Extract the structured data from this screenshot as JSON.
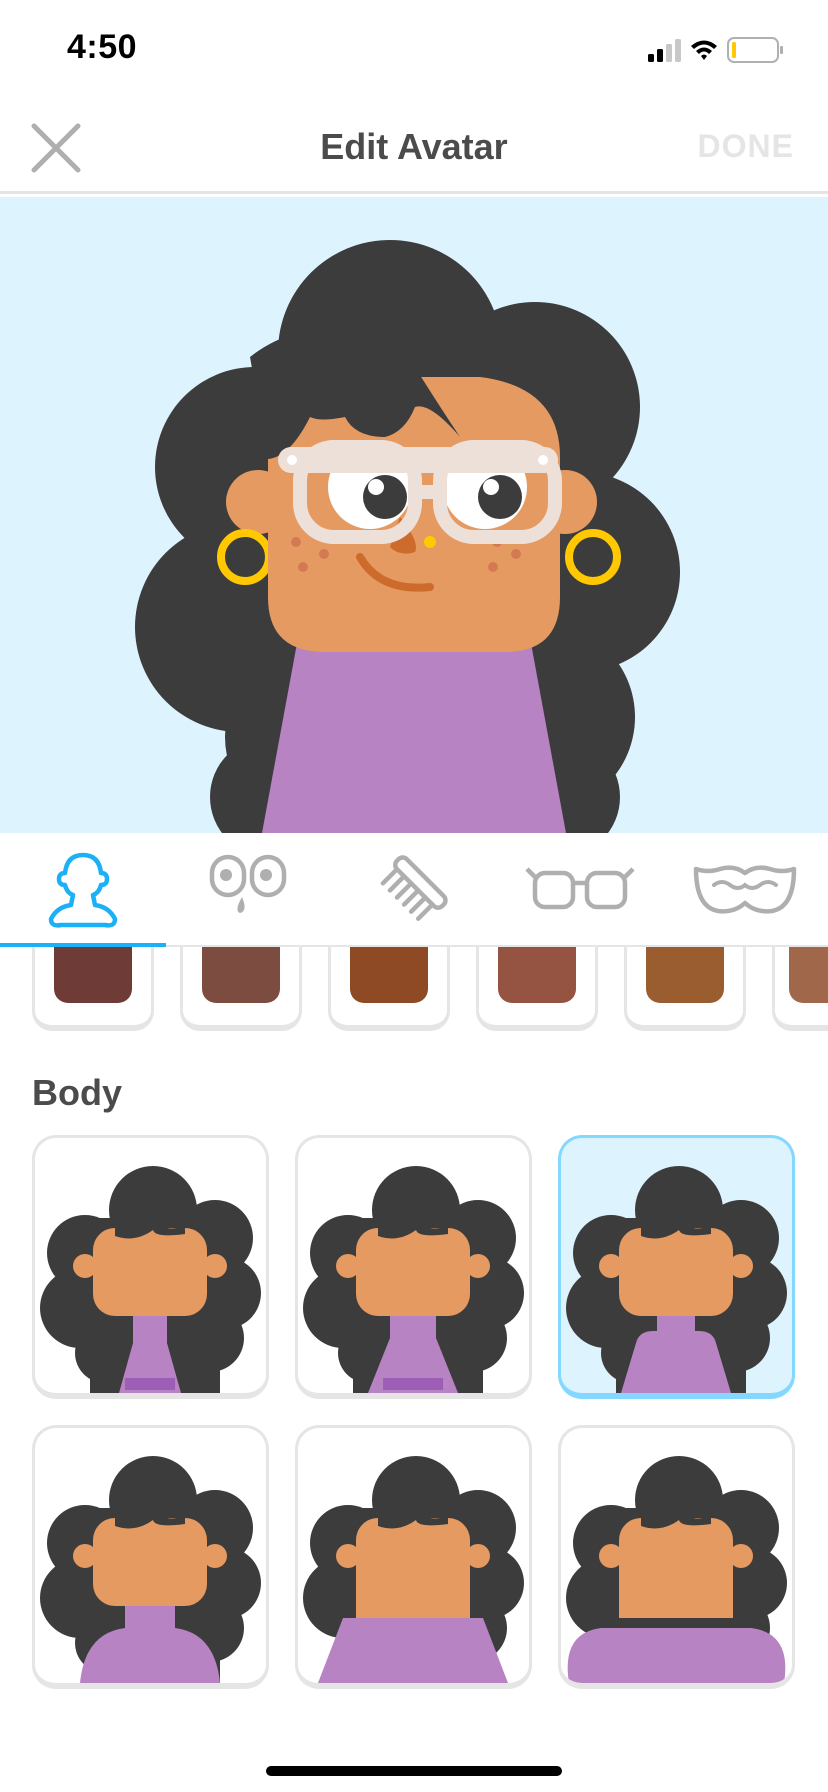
{
  "status_bar": {
    "time": "4:50",
    "icons": [
      "signal-icon",
      "wifi-icon",
      "battery-icon"
    ]
  },
  "header": {
    "title": "Edit Avatar",
    "close_icon": "close-icon",
    "done_label": "DONE"
  },
  "tabs": [
    {
      "name": "body",
      "icon": "body-icon",
      "active": true
    },
    {
      "name": "face",
      "icon": "face-icon",
      "active": false
    },
    {
      "name": "hair",
      "icon": "comb-icon",
      "active": false
    },
    {
      "name": "glasses",
      "icon": "glasses-icon",
      "active": false
    },
    {
      "name": "facial-hair",
      "icon": "mustache-icon",
      "active": false
    }
  ],
  "skin_swatches": [
    "#6f3b37",
    "#7d4c41",
    "#8d4a25",
    "#955441",
    "#9a5d30",
    "#a1674a"
  ],
  "body_section": {
    "title": "Body",
    "options_selected": 3
  },
  "colors": {
    "accent": "#1cb0f6",
    "preview_bg": "#ddf4ff",
    "hair": "#3c3c3c",
    "skin": "#e59a62",
    "shirt": "#b783c2",
    "earring": "#ffc800",
    "glasses": "#ede0d9"
  }
}
